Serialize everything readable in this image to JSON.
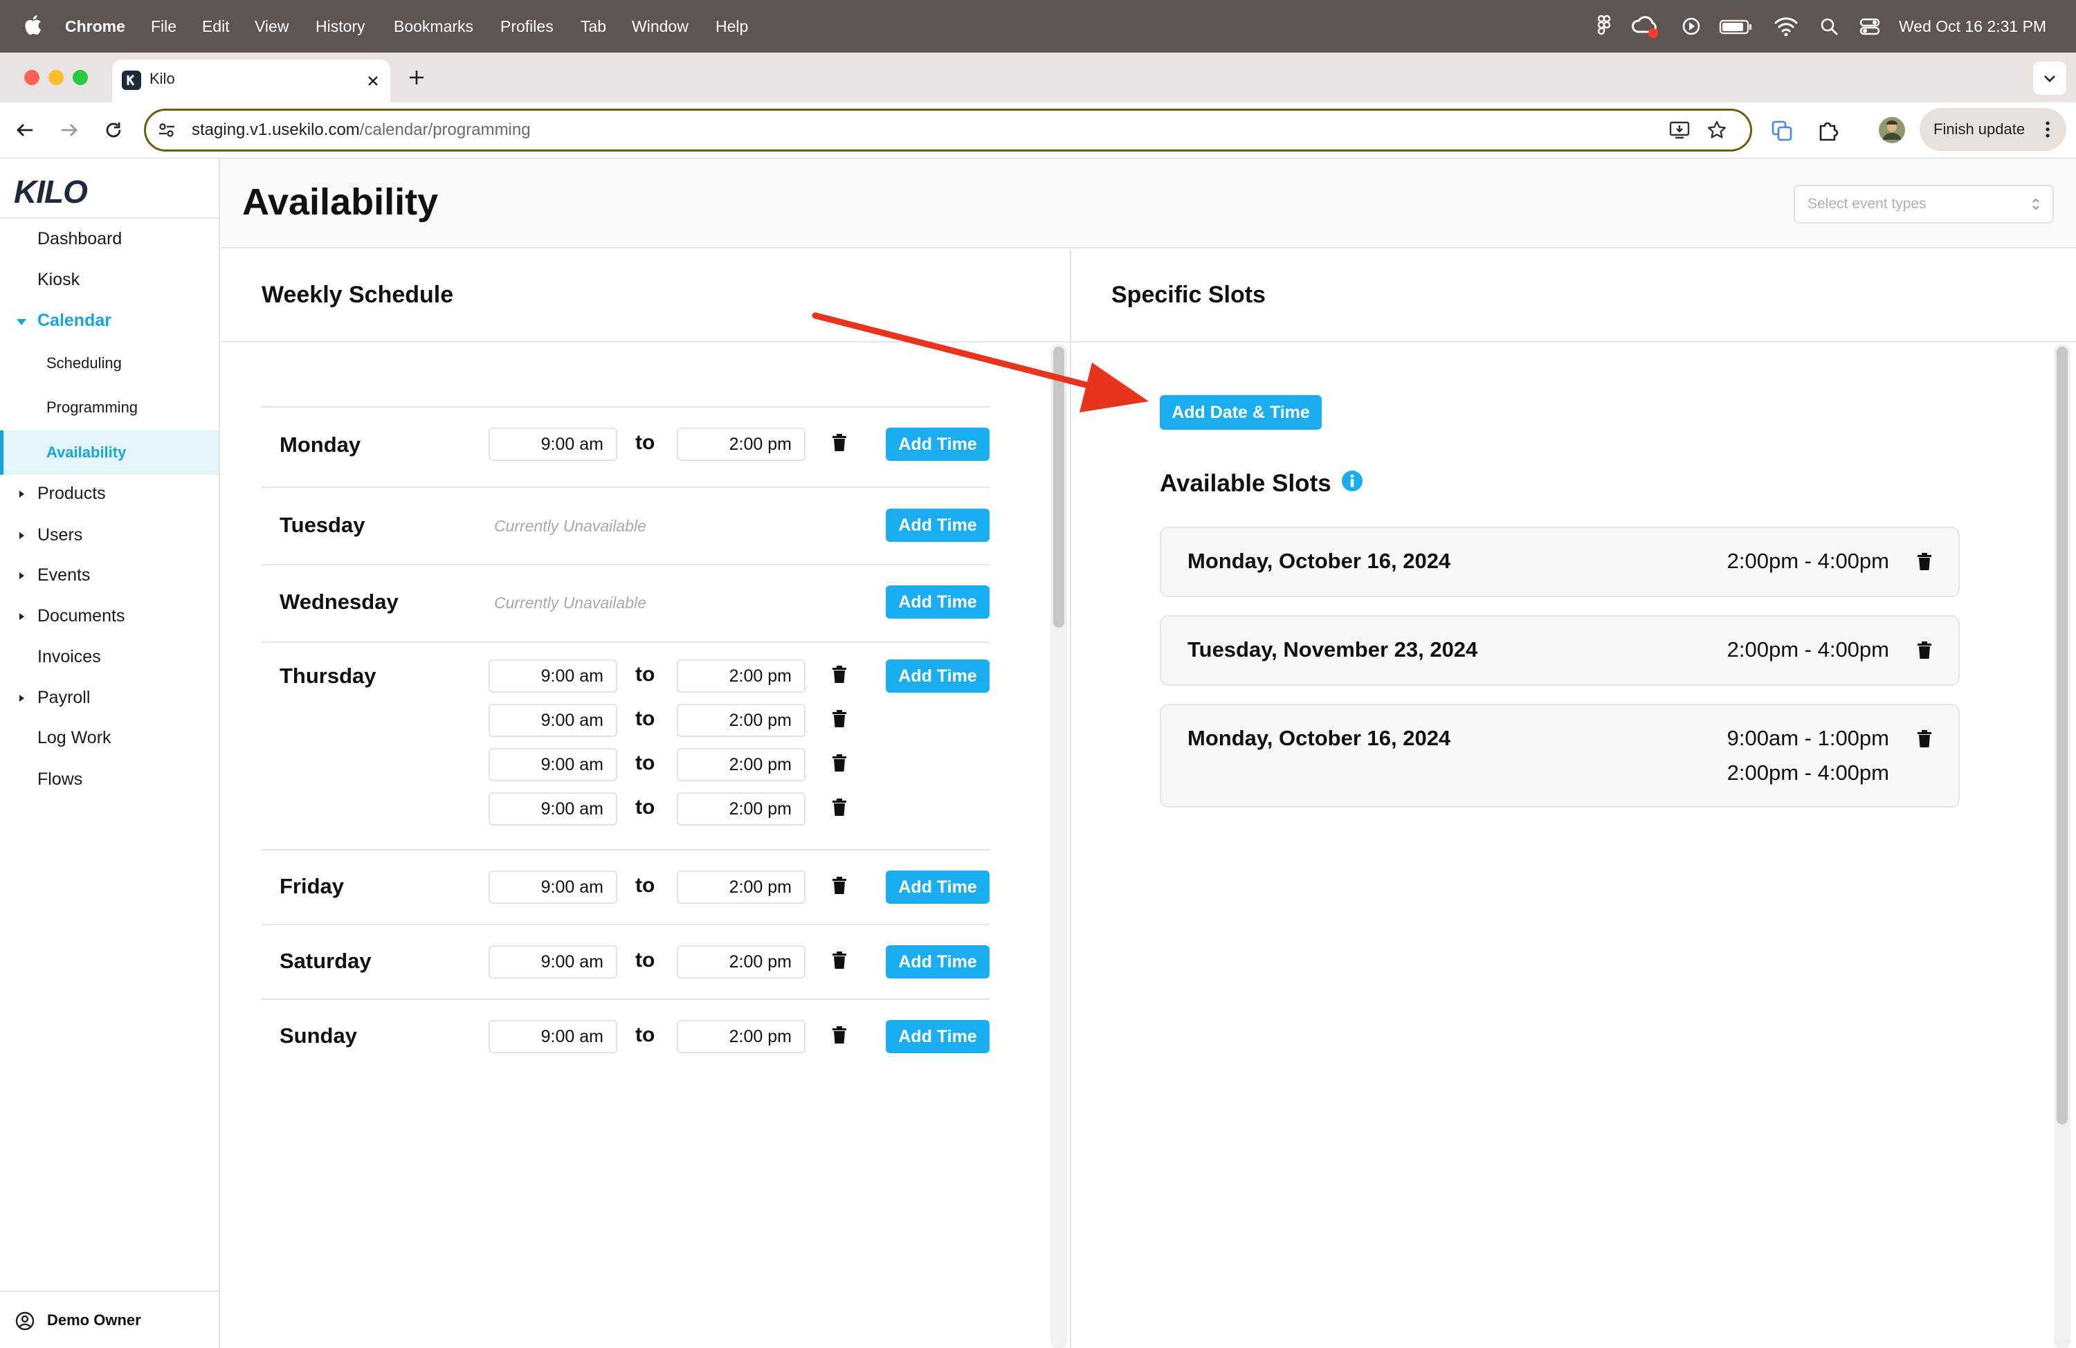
{
  "menubar": {
    "app_name": "Chrome",
    "items": [
      "File",
      "Edit",
      "View",
      "History",
      "Bookmarks",
      "Profiles",
      "Tab",
      "Window",
      "Help"
    ],
    "datetime": "Wed Oct 16  2:31 PM"
  },
  "browser": {
    "tab_title": "Kilo",
    "url_host": "staging.v1.usekilo.com",
    "url_path": "/calendar/programming",
    "finish_update_label": "Finish update"
  },
  "sidebar": {
    "logo": "KILO",
    "items": [
      {
        "label": "Dashboard"
      },
      {
        "label": "Kiosk"
      },
      {
        "label": "Calendar"
      },
      {
        "label": "Scheduling"
      },
      {
        "label": "Programming"
      },
      {
        "label": "Availability"
      },
      {
        "label": "Products"
      },
      {
        "label": "Users"
      },
      {
        "label": "Events"
      },
      {
        "label": "Documents"
      },
      {
        "label": "Invoices"
      },
      {
        "label": "Payroll"
      },
      {
        "label": "Log Work"
      },
      {
        "label": "Flows"
      }
    ],
    "user_name": "Demo Owner"
  },
  "page": {
    "title": "Availability",
    "event_types_placeholder": "Select event types"
  },
  "weekly": {
    "heading": "Weekly Schedule",
    "to_label": "to",
    "add_time_label": "Add Time",
    "unavailable_label": "Currently Unavailable",
    "days": [
      {
        "name": "Monday",
        "start": "9:00 am",
        "end": "2:00 pm"
      },
      {
        "name": "Tuesday"
      },
      {
        "name": "Wednesday"
      },
      {
        "name": "Thursday",
        "start": "9:00 am",
        "end": "2:00 pm"
      },
      {
        "name": "Friday",
        "start": "9:00 am",
        "end": "2:00 pm"
      },
      {
        "name": "Saturday",
        "start": "9:00 am",
        "end": "2:00 pm"
      },
      {
        "name": "Sunday",
        "start": "9:00 am",
        "end": "2:00 pm"
      }
    ]
  },
  "specific": {
    "heading": "Specific Slots",
    "add_date_time_label": "Add Date & Time",
    "available_heading": "Available Slots",
    "slots": [
      {
        "date": "Monday, October 16, 2024",
        "times": [
          "2:00pm - 4:00pm"
        ]
      },
      {
        "date": "Tuesday, November 23, 2024",
        "times": [
          "2:00pm - 4:00pm"
        ]
      },
      {
        "date": "Monday, October 16, 2024",
        "times": [
          "9:00am - 1:00pm",
          "2:00pm - 4:00pm"
        ]
      }
    ]
  },
  "colors": {
    "accent": "#1aaef0",
    "annotation_arrow": "#e8341c",
    "menubar": "#5e5451"
  }
}
